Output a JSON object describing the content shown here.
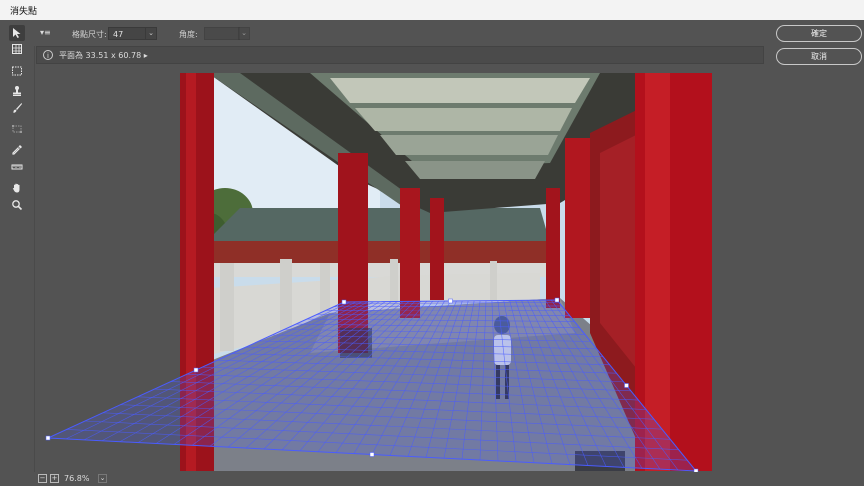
{
  "window": {
    "title": "消失點"
  },
  "options": {
    "grid_size_label": "格點尺寸:",
    "grid_size_value": "47",
    "angle_label": "角度:",
    "angle_value": ""
  },
  "info": {
    "text": "平面為 33.51 x 60.78 ▸"
  },
  "buttons": {
    "ok": "確定",
    "cancel": "取消"
  },
  "status": {
    "zoom": "76.8%"
  },
  "icons": [
    "edit-plane-icon",
    "create-plane-icon",
    "marquee-icon",
    "stamp-icon",
    "brush-icon",
    "transform-icon",
    "eyedropper-icon",
    "measure-icon",
    "hand-icon",
    "zoom-icon",
    "info-icon",
    "zoom-out-icon",
    "zoom-in-icon",
    "zoom-dropdown-icon",
    "panel-menu-icon"
  ],
  "colors": {
    "grid": "#4a5cff",
    "accent_red": "#b3101c",
    "sky": "#cfe0f0"
  }
}
